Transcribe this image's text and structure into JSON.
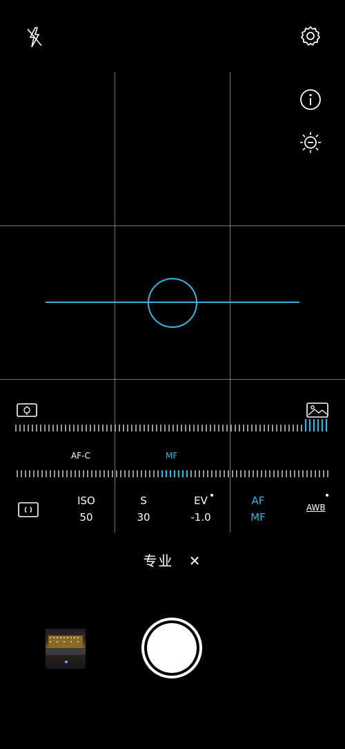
{
  "top_icons": {
    "flash": "flash-off-icon",
    "settings": "gear-icon",
    "info": "info-icon",
    "exposure": "exposure-icon"
  },
  "colors": {
    "accent": "#33b5e5",
    "grid": "#888888",
    "background": "#000000"
  },
  "scale_icons": {
    "left": "macro-flower-icon",
    "right": "landscape-icon"
  },
  "focus_modes": {
    "af_c": "AF-C",
    "mf": "MF"
  },
  "params": [
    {
      "label": "ISO",
      "value": "50"
    },
    {
      "label": "S",
      "value": "30"
    },
    {
      "label": "EV",
      "value": "-1.0"
    },
    {
      "label": "AF",
      "value": "MF"
    }
  ],
  "awb": "AWB",
  "metering_icon": "metering-icon",
  "mode": {
    "label": "专业",
    "close": "✕"
  },
  "gallery_thumbnail": "gallery-thumbnail",
  "shutter": "shutter-button"
}
